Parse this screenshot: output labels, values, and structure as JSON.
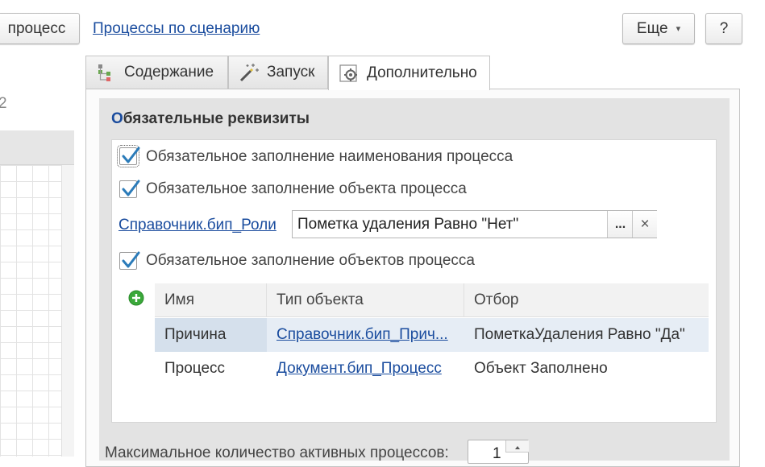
{
  "toolbar": {
    "process_button": "процесс",
    "scenario_link": "Процессы по сценарию",
    "more_button": "Еще",
    "more_arrow": "▾",
    "help_button": "?"
  },
  "left": {
    "counter": "2"
  },
  "tabs": [
    {
      "label": "Содержание",
      "icon": "tree-icon"
    },
    {
      "label": "Запуск",
      "icon": "magic-wand-icon"
    },
    {
      "label": "Дополнительно",
      "icon": "settings-icon"
    }
  ],
  "group": {
    "title_first": "О",
    "title_rest": "бязательные реквизиты"
  },
  "checkboxes": {
    "name_required": {
      "label": "Обязательное заполнение наименования процесса",
      "checked": true
    },
    "object_required": {
      "label": "Обязательное заполнение объекта процесса",
      "checked": true
    },
    "objects_required": {
      "label": "Обязательное заполнение объектов процесса",
      "checked": true
    }
  },
  "roles": {
    "link": "Справочник.бип_Роли",
    "filter_value": "Пометка удаления Равно \"Нет\"",
    "select_button": "...",
    "clear_button": "×"
  },
  "table": {
    "headers": [
      "Имя",
      "Тип объекта",
      "Отбор"
    ],
    "rows": [
      {
        "name": "Причина",
        "type": "Справочник.бип_Прич...",
        "filter": "ПометкаУдаления Равно \"Да\""
      },
      {
        "name": "Процесс",
        "type": "Документ.бип_Процесс",
        "filter": "Объект Заполнено"
      }
    ]
  },
  "max_active": {
    "label": "Максимальное количество активных процессов:",
    "value": "1"
  },
  "colors": {
    "link": "#1a4c9e",
    "check": "#2b7bb9",
    "selected_row": "#d5e0ec",
    "add_icon": "#3aa83a"
  }
}
